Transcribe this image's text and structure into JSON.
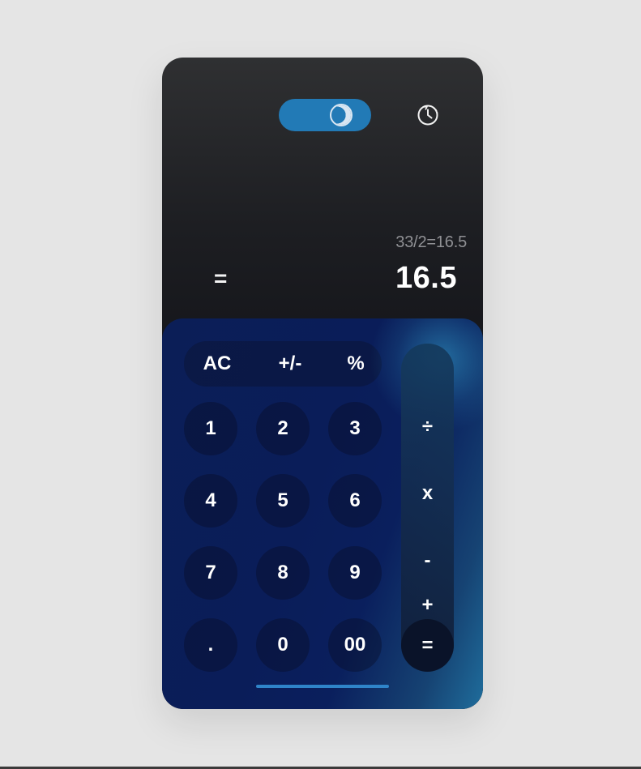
{
  "top": {
    "theme_toggle": {
      "icon": "theme-toggle-icon",
      "color": "#227ab6"
    },
    "history_icon": "history-clock-icon"
  },
  "display": {
    "expression": "33/2=16.5",
    "equals_symbol": "=",
    "result": "16.5"
  },
  "keypad": {
    "top_row": [
      {
        "label": "AC"
      },
      {
        "label": "+/-"
      },
      {
        "label": "%"
      }
    ],
    "digits": [
      [
        "1",
        "2",
        "3"
      ],
      [
        "4",
        "5",
        "6"
      ],
      [
        "7",
        "8",
        "9"
      ],
      [
        ".",
        "0",
        "00"
      ]
    ],
    "operators": [
      "÷",
      "x",
      "-",
      "+",
      "="
    ]
  },
  "colors": {
    "accent": "#227ab6",
    "keypad_blue": "#0a1d59",
    "keypad_teal": "#1f6d9c"
  }
}
